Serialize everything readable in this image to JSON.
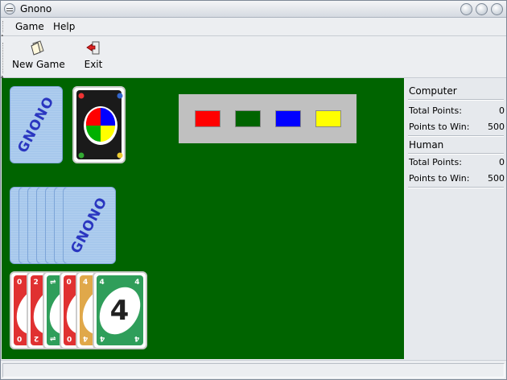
{
  "window": {
    "title": "Gnono"
  },
  "menu": {
    "items": [
      "Game",
      "Help"
    ]
  },
  "toolbar": {
    "new_game": "New Game",
    "exit": "Exit"
  },
  "table": {
    "background": "#006400",
    "deck_logo": "GNONO",
    "palette_colors": [
      "#ff0000",
      "#006400",
      "#0000ff",
      "#ffff00"
    ],
    "computer_hand_count": 7,
    "discard": "wild",
    "human_hand": [
      {
        "value": "0",
        "color": "#e03131"
      },
      {
        "value": "2",
        "color": "#e03131"
      },
      {
        "value": "⇌",
        "color": "#2f9e5a"
      },
      {
        "value": "0",
        "color": "#e03131"
      },
      {
        "value": "4",
        "color": "#e0a84a"
      },
      {
        "value": "4",
        "color": "#2f9e5a"
      }
    ]
  },
  "scores": {
    "computer": {
      "title": "Computer",
      "total_label": "Total Points:",
      "total": "0",
      "to_win_label": "Points to Win:",
      "to_win": "500"
    },
    "human": {
      "title": "Human",
      "total_label": "Total Points:",
      "total": "0",
      "to_win_label": "Points to Win:",
      "to_win": "500"
    }
  },
  "status": {
    "text": ""
  }
}
